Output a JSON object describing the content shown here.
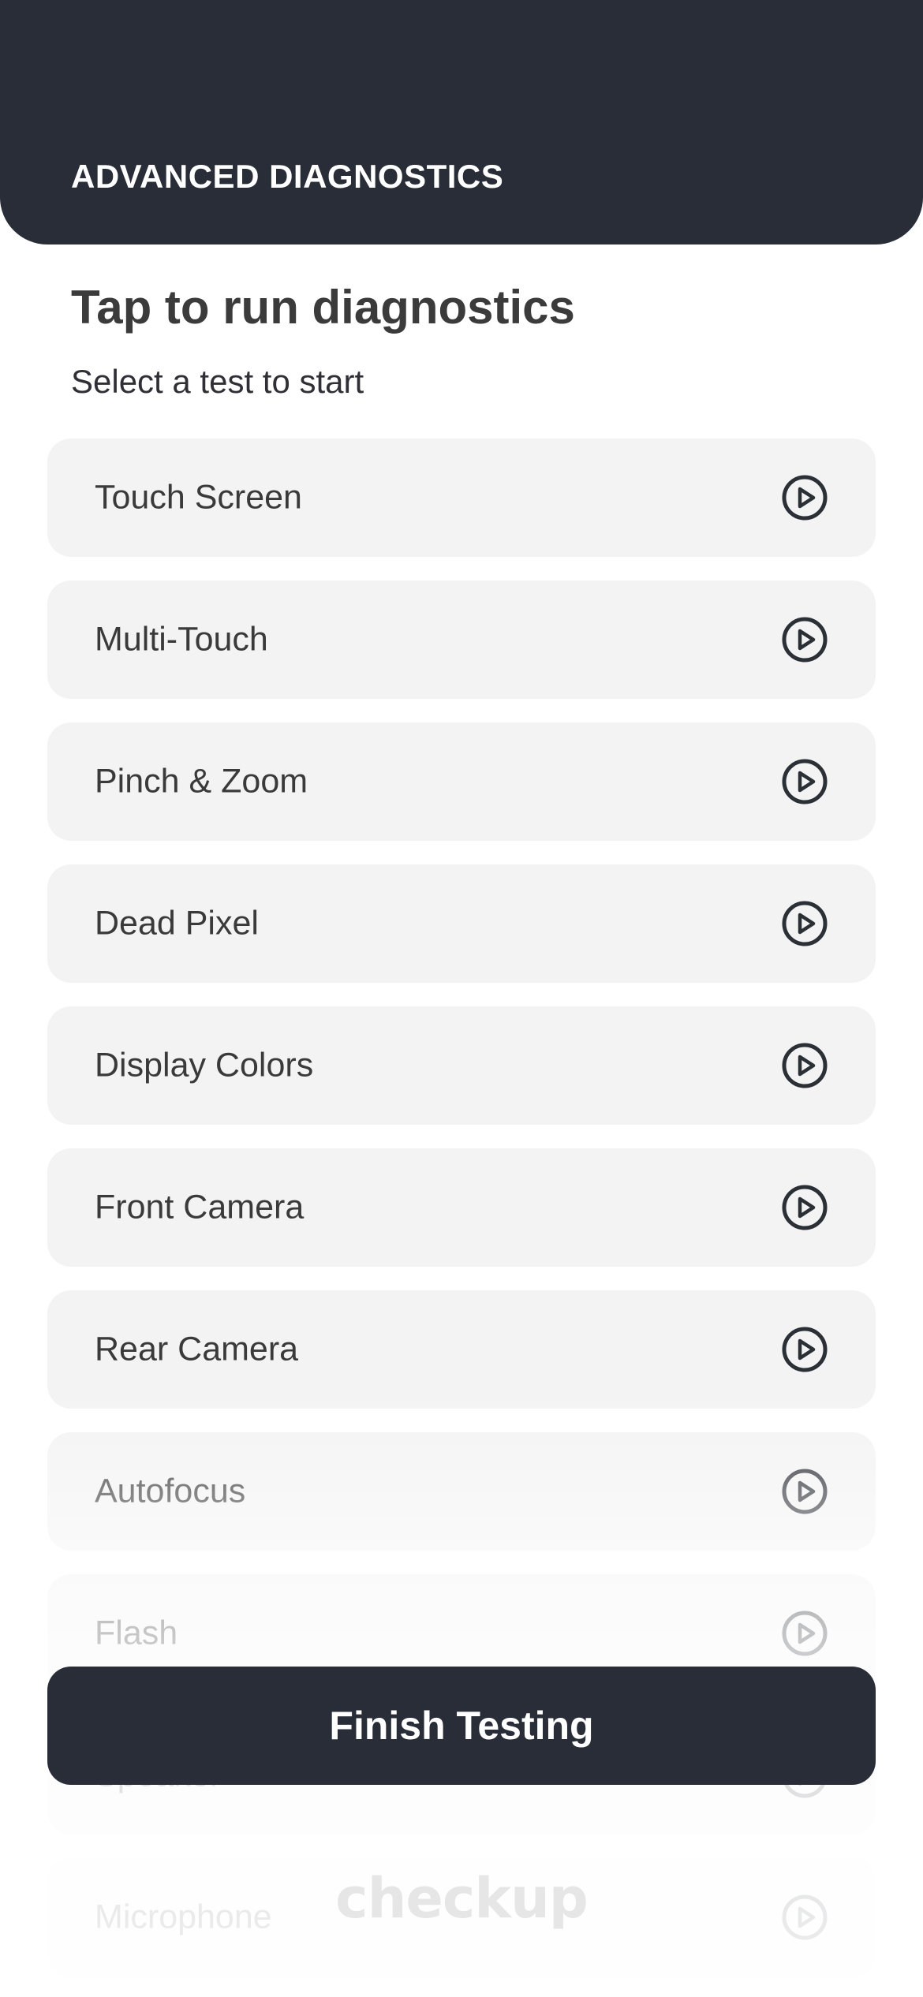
{
  "header": {
    "title": "ADVANCED DIAGNOSTICS"
  },
  "main": {
    "heading": "Tap to run diagnostics",
    "subheading": "Select a test to start"
  },
  "tests": [
    {
      "label": "Touch Screen",
      "icon": "play-circle-icon"
    },
    {
      "label": "Multi-Touch",
      "icon": "play-circle-icon"
    },
    {
      "label": "Pinch & Zoom",
      "icon": "play-circle-icon"
    },
    {
      "label": "Dead Pixel",
      "icon": "play-circle-icon"
    },
    {
      "label": "Display Colors",
      "icon": "play-circle-icon"
    },
    {
      "label": "Front Camera",
      "icon": "play-circle-icon"
    },
    {
      "label": "Rear Camera",
      "icon": "play-circle-icon"
    },
    {
      "label": "Autofocus",
      "icon": "play-circle-icon"
    },
    {
      "label": "Flash",
      "icon": "play-circle-icon"
    },
    {
      "label": "Speaker",
      "icon": "play-circle-icon"
    },
    {
      "label": "Microphone",
      "icon": "play-circle-icon"
    }
  ],
  "footer": {
    "finish_label": "Finish Testing",
    "logo_text": "checkup"
  },
  "colors": {
    "header_bg": "#282d37",
    "item_bg": "#f3f3f3",
    "button_bg": "#282d37",
    "text_primary": "#3a3a3a"
  }
}
